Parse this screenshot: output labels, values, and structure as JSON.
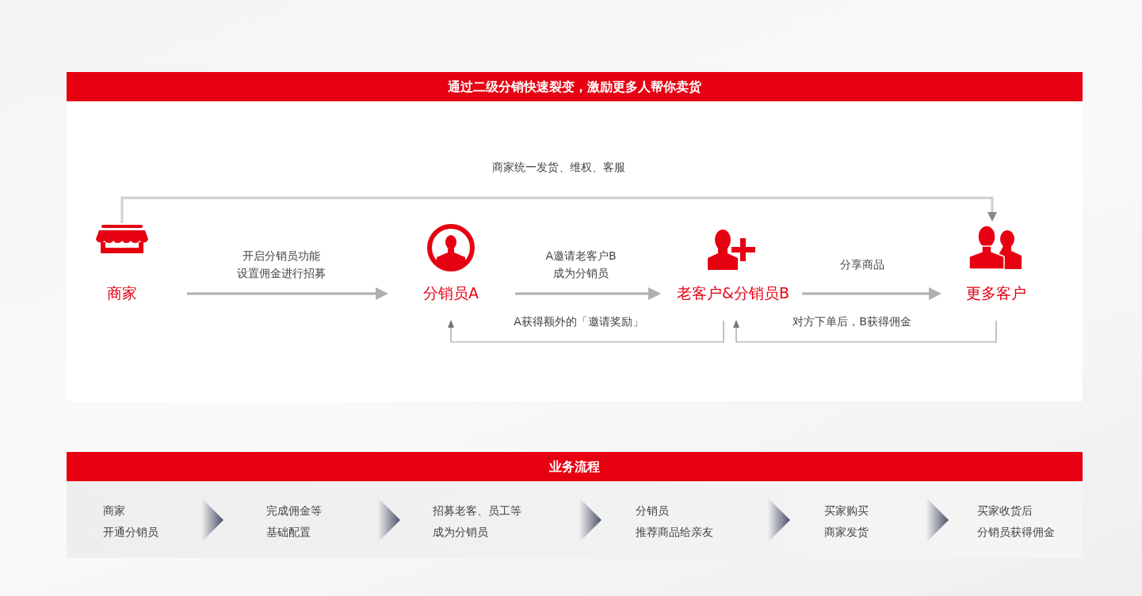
{
  "diagram": {
    "title": "通过二级分销快速裂变，激励更多人帮你卖货",
    "top_label": "商家统一发货、维权、客服",
    "nodes": [
      {
        "kind": "store",
        "label": "商家"
      },
      {
        "kind": "person",
        "label": "分销员A"
      },
      {
        "kind": "person-plus",
        "label": "老客户&分销员B"
      },
      {
        "kind": "group",
        "label": "更多客户"
      }
    ],
    "arrow_labels": [
      [
        "开启分销员功能",
        "设置佣金进行招募"
      ],
      [
        "A邀请老客户B",
        "成为分销员"
      ],
      [
        "分享商品"
      ]
    ],
    "return_labels": [
      "A获得额外的「邀请奖励」",
      "对方下单后，B获得佣金"
    ]
  },
  "process": {
    "title": "业务流程",
    "steps": [
      [
        "商家",
        "开通分销员"
      ],
      [
        "完成佣金等",
        "基础配置"
      ],
      [
        "招募老客、员工等",
        "成为分销员"
      ],
      [
        "分销员",
        "推荐商品给亲友"
      ],
      [
        "买家购买",
        "商家发货"
      ],
      [
        "买家收货后",
        "分销员获得佣金"
      ]
    ]
  }
}
